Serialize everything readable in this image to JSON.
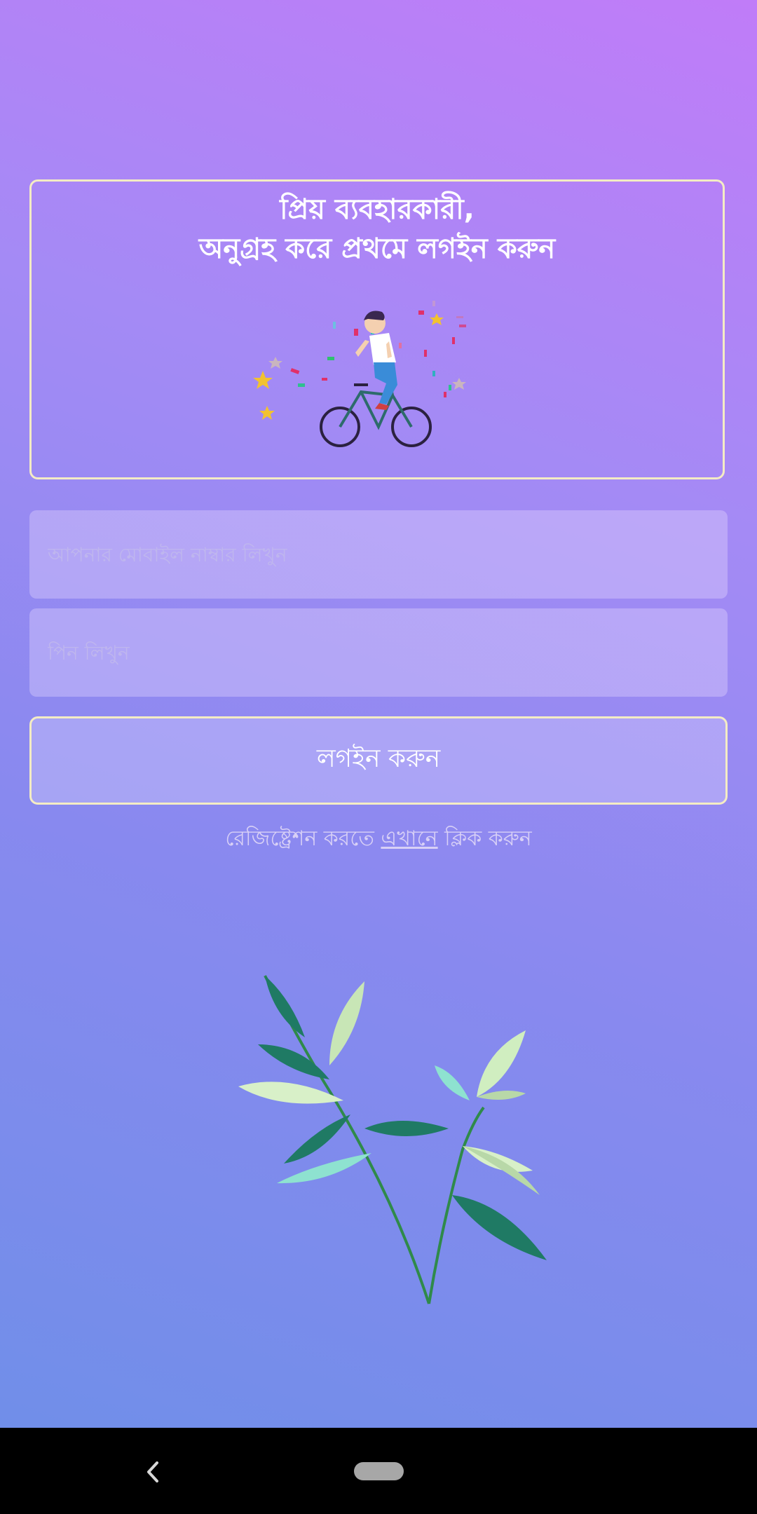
{
  "welcome": {
    "line1": "প্রিয় ব্যবহারকারী,",
    "line2": "অনুগ্রহ করে প্রথমে লগইন করুন",
    "illustration": "cyclist-illustration"
  },
  "form": {
    "mobile_placeholder": "আপনার মোবাইল নাম্বার লিখুন",
    "mobile_value": "",
    "pin_placeholder": "পিন লিখুন",
    "pin_value": "",
    "login_label": "লগইন করুন"
  },
  "register": {
    "prefix": "রেজিষ্ট্রেশন করতে ",
    "link": "এখানে",
    "suffix": " ক্লিক করুন"
  },
  "decoration": {
    "plant": "plant-illustration"
  },
  "navbar": {
    "back_icon": "chevron-left-icon",
    "home_icon": "home-pill-icon"
  },
  "colors": {
    "card_border": "#f4ecc4",
    "background_top": "#c07cf8",
    "background_bottom": "#6d8fe8"
  }
}
